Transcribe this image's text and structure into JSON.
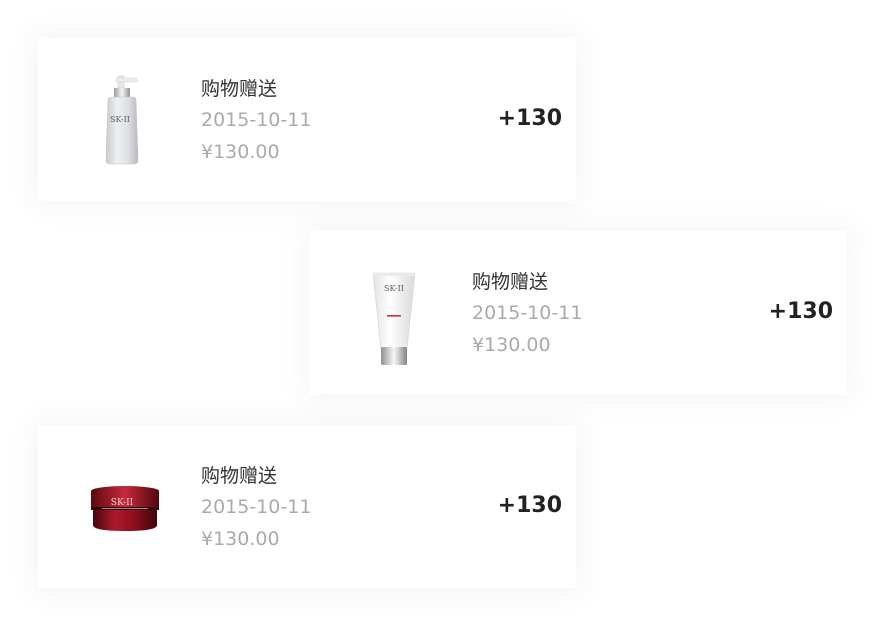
{
  "records": [
    {
      "title": "购物赠送",
      "date": "2015-10-11",
      "amount": "¥130.00",
      "points": "+130",
      "product_icon": "pump-bottle-icon"
    },
    {
      "title": "购物赠送",
      "date": "2015-10-11",
      "amount": "¥130.00",
      "points": "+130",
      "product_icon": "cream-tube-icon"
    },
    {
      "title": "购物赠送",
      "date": "2015-10-11",
      "amount": "¥130.00",
      "points": "+130",
      "product_icon": "cream-jar-icon"
    }
  ],
  "brand_text": "SK-II",
  "colors": {
    "title": "#333333",
    "meta": "#aaaaaa",
    "points": "#222222",
    "jar": "#8b0f1c"
  }
}
